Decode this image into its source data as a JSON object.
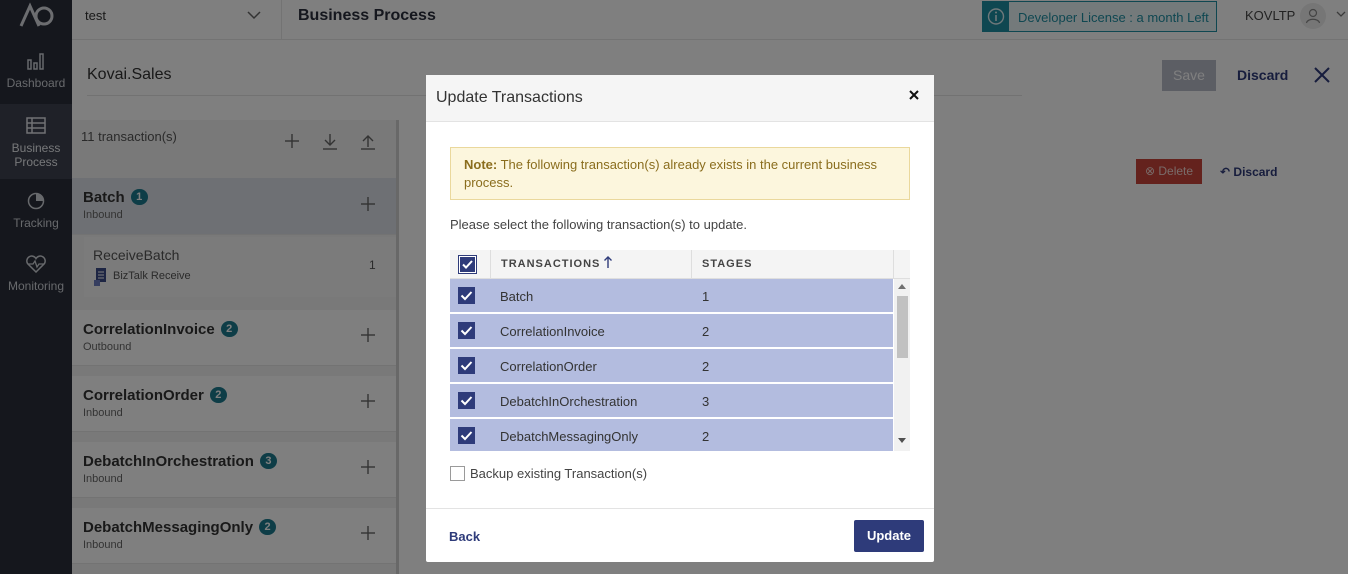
{
  "nav": {
    "items": [
      {
        "label": "Dashboard",
        "icon": "dashboard-icon"
      },
      {
        "label": "Business Process",
        "icon": "business-process-icon"
      },
      {
        "label": "Tracking",
        "icon": "tracking-icon"
      },
      {
        "label": "Monitoring",
        "icon": "monitoring-icon"
      }
    ],
    "active": "Business Process"
  },
  "header": {
    "project": "test",
    "title": "Business Process",
    "license": "Developer License : a month Left",
    "user": "KOVLTP"
  },
  "page": {
    "app_name": "Kovai.Sales",
    "save_label": "Save",
    "discard_label": "Discard",
    "count_label": "11 transaction(s)",
    "delete_label": "Delete",
    "discard2_label": "Discard"
  },
  "transactions": [
    {
      "name": "Batch",
      "count": "1",
      "direction": "Inbound"
    },
    {
      "name": "CorrelationInvoice",
      "count": "2",
      "direction": "Outbound"
    },
    {
      "name": "CorrelationOrder",
      "count": "2",
      "direction": "Inbound"
    },
    {
      "name": "DebatchInOrchestration",
      "count": "3",
      "direction": "Inbound"
    },
    {
      "name": "DebatchMessagingOnly",
      "count": "2",
      "direction": "Inbound"
    }
  ],
  "stage": {
    "name": "ReceiveBatch",
    "sub": "BizTalk Receive",
    "num": "1"
  },
  "modal": {
    "title": "Update Transactions",
    "note_label": "Note:",
    "note_text": " The following transaction(s) already exists in the current business process.",
    "instruction": "Please select the following transaction(s) to update.",
    "col_transactions": "TRANSACTIONS",
    "col_stages": "STAGES",
    "rows": [
      {
        "name": "Batch",
        "stages": "1",
        "checked": true
      },
      {
        "name": "CorrelationInvoice",
        "stages": "2",
        "checked": true
      },
      {
        "name": "CorrelationOrder",
        "stages": "2",
        "checked": true
      },
      {
        "name": "DebatchInOrchestration",
        "stages": "3",
        "checked": true
      },
      {
        "name": "DebatchMessagingOnly",
        "stages": "2",
        "checked": true
      }
    ],
    "backup_label": "Backup existing Transaction(s)",
    "back_label": "Back",
    "update_label": "Update"
  },
  "colors": {
    "accent": "#2e3b7a",
    "teal": "#1c7b8f",
    "row_selected": "#b3bcdf",
    "danger": "#c9453a"
  }
}
